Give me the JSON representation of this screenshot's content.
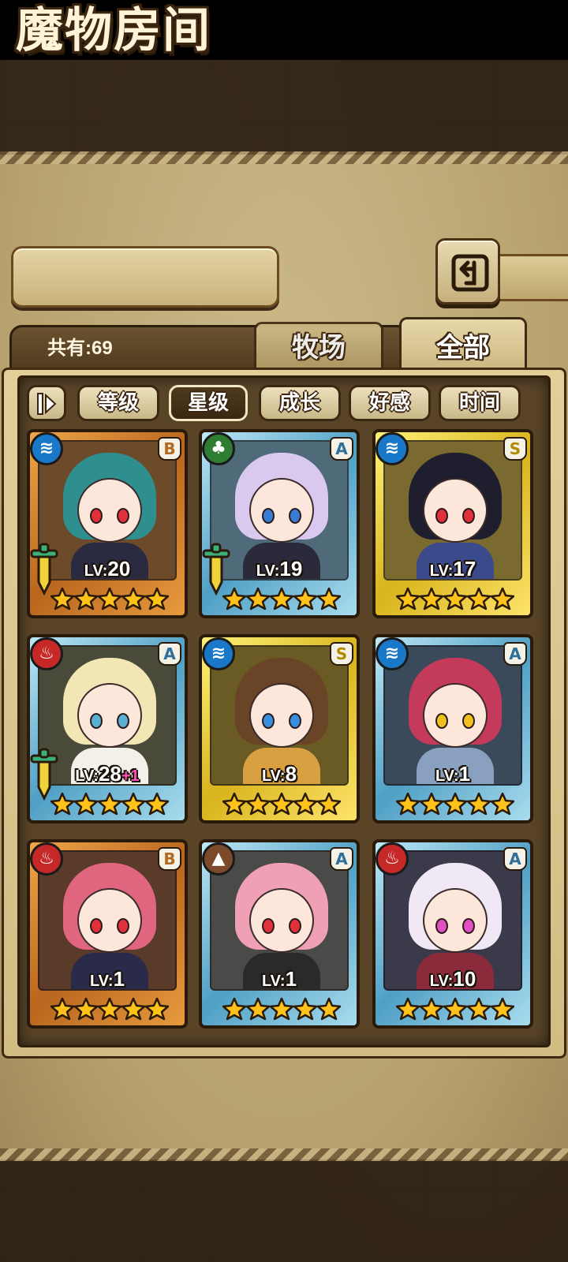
{
  "header": {
    "title": "魔物房间",
    "back_icon": "back-arrow-icon"
  },
  "summary": {
    "count_label": "共有:69"
  },
  "tabs": [
    {
      "label": "牧场",
      "active": false
    },
    {
      "label": "全部",
      "active": true
    }
  ],
  "sort": {
    "order_icon": "sort-order-icon",
    "options": [
      {
        "label": "等级",
        "active": false
      },
      {
        "label": "星级",
        "active": true
      },
      {
        "label": "成长",
        "active": false
      },
      {
        "label": "好感",
        "active": false
      },
      {
        "label": "时间",
        "active": false
      }
    ]
  },
  "colors": {
    "frame_bronze": "#d8862e",
    "frame_silver": "#6fb8d8",
    "frame_gold": "#f0d23a",
    "star": "#ffc21a",
    "bonus": "#ff4fb8"
  },
  "monsters": [
    {
      "element": "water",
      "rank": "B",
      "level": "20",
      "bonus": "",
      "stars": 5,
      "frame": "bronze",
      "equipped": true
    },
    {
      "element": "nature",
      "rank": "A",
      "level": "19",
      "bonus": "",
      "stars": 5,
      "frame": "silver",
      "equipped": true
    },
    {
      "element": "water",
      "rank": "S",
      "level": "17",
      "bonus": "",
      "stars": 5,
      "frame": "gold",
      "equipped": false
    },
    {
      "element": "fire",
      "rank": "A",
      "level": "28",
      "bonus": "+1",
      "stars": 5,
      "frame": "silver",
      "equipped": true
    },
    {
      "element": "water",
      "rank": "S",
      "level": "8",
      "bonus": "",
      "stars": 5,
      "frame": "gold",
      "equipped": false
    },
    {
      "element": "water",
      "rank": "A",
      "level": "1",
      "bonus": "",
      "stars": 5,
      "frame": "silver",
      "equipped": false
    },
    {
      "element": "fire",
      "rank": "B",
      "level": "1",
      "bonus": "",
      "stars": 5,
      "frame": "bronze",
      "equipped": false
    },
    {
      "element": "earth",
      "rank": "A",
      "level": "1",
      "bonus": "",
      "stars": 5,
      "frame": "silver",
      "equipped": false
    },
    {
      "element": "fire",
      "rank": "A",
      "level": "10",
      "bonus": "",
      "stars": 5,
      "frame": "silver",
      "equipped": false
    }
  ]
}
